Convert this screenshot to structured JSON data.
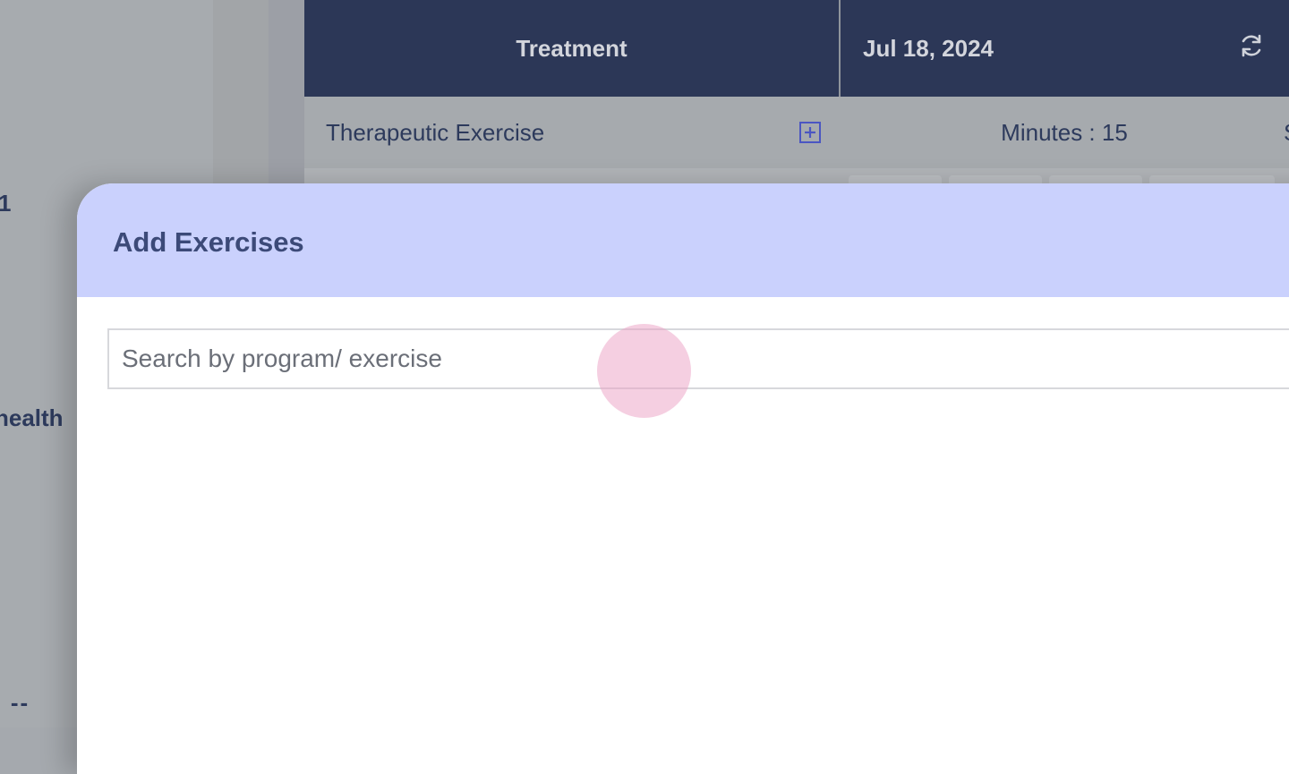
{
  "background": {
    "fragments": {
      "number": "1",
      "word": "health",
      "dash": ": --"
    },
    "table": {
      "header": {
        "treatment_label": "Treatment",
        "date_label": "Jul 18, 2024",
        "refresh_icon": "refresh-icon"
      },
      "row": {
        "label": "Therapeutic Exercise",
        "add_icon": "plus-square-icon",
        "minutes": "Minutes : 15",
        "cut_text": "S"
      }
    }
  },
  "modal": {
    "title": "Add Exercises",
    "search": {
      "placeholder": "Search by program/ exercise",
      "value": ""
    }
  },
  "colors": {
    "header_navy": "#2c3757",
    "modal_header": "#cad1fd",
    "title_text": "#3c4a78",
    "accent_icon": "#4b56c2",
    "click_indicator": "#eca0c4"
  }
}
